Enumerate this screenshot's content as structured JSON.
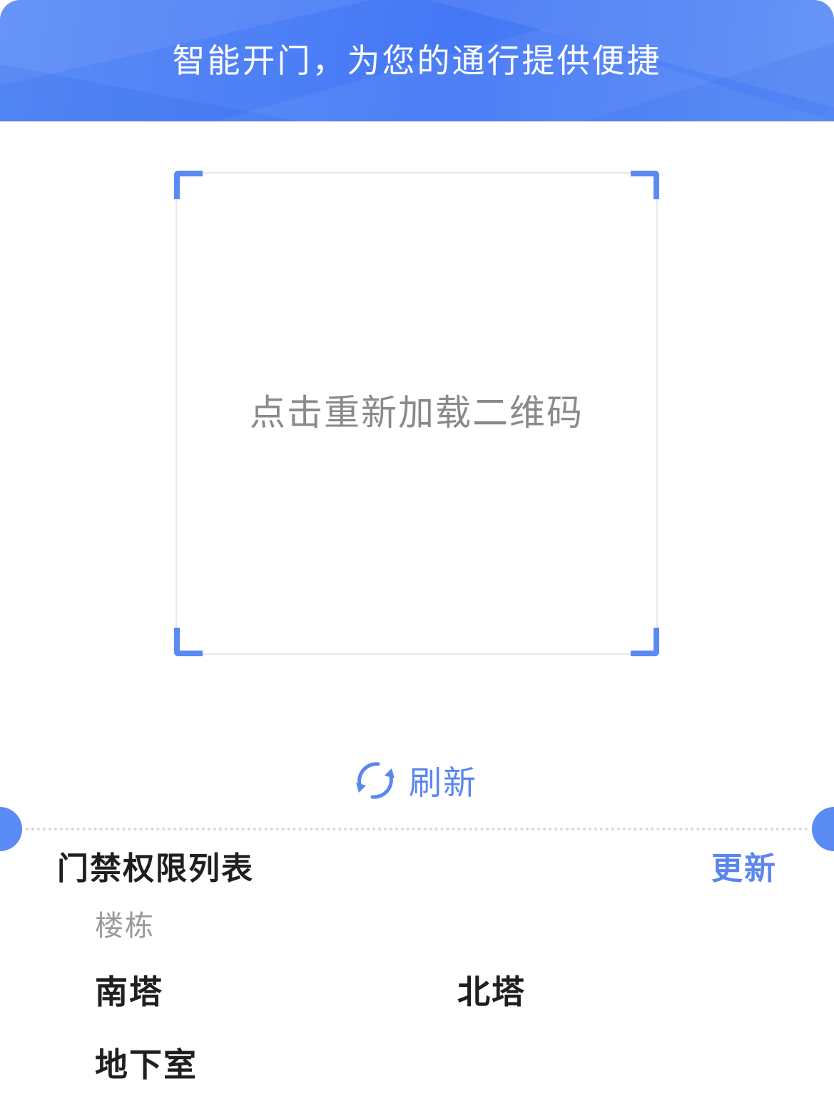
{
  "header": {
    "title": "智能开门，为您的通行提供便捷"
  },
  "qr_panel": {
    "hint": "点击重新加载二维码"
  },
  "refresh": {
    "icon": "refresh-icon",
    "label": "刷新"
  },
  "access_list": {
    "title": "门禁权限列表",
    "update_label": "更新",
    "section_label": "楼栋",
    "buildings": [
      {
        "name": "南塔"
      },
      {
        "name": "北塔"
      },
      {
        "name": "地下室"
      }
    ]
  },
  "colors": {
    "brand_blue": "#4477f5",
    "accent_blue": "#5b86ef",
    "text_dark": "#1f1f1f",
    "text_muted": "#9a9a9a"
  }
}
